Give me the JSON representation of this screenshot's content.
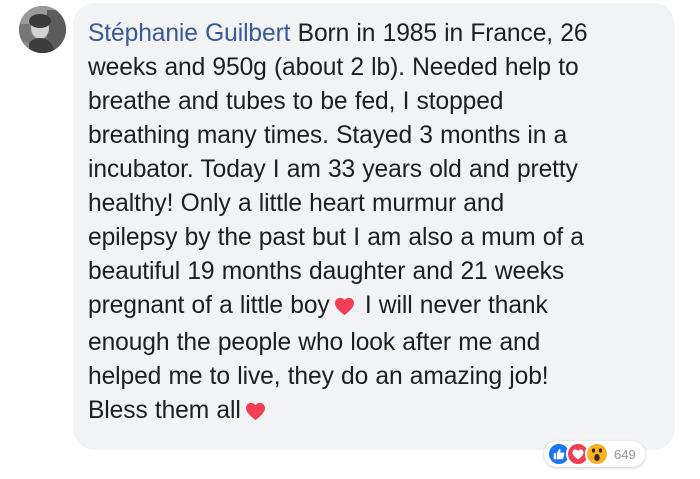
{
  "comment": {
    "author": "Stéphanie Guilbert",
    "text_lines": [
      " Born in 1985 in France, 26",
      "weeks and 950g (about 2 lb). Needed help to",
      "breathe and tubes to be fed, I stopped",
      "breathing many times. Stayed 3 months in a",
      "incubator. Today I am 33 years old and pretty",
      "healthy! Only a little heart murmur and",
      "epilepsy by the past but I am also a mum of a",
      "beautiful 19 months daughter and 21 weeks",
      "pregnant of a little boy",
      " I will never thank",
      "enough the people who look after me and",
      "helped me to live, they do an amazing job!",
      "Bless them all"
    ],
    "inline_icons": [
      "heart-icon",
      "heart-icon"
    ]
  },
  "reactions": {
    "icons": [
      "like-icon",
      "love-icon",
      "wow-icon"
    ],
    "count": "649"
  },
  "colors": {
    "author_link": "#385898",
    "bubble_bg": "#f2f3f5",
    "text": "#1c1e21",
    "heart": "#f33e58",
    "like": "#1877f2",
    "love": "#f33e58",
    "wow": "#f7b125",
    "count": "#90949c"
  }
}
